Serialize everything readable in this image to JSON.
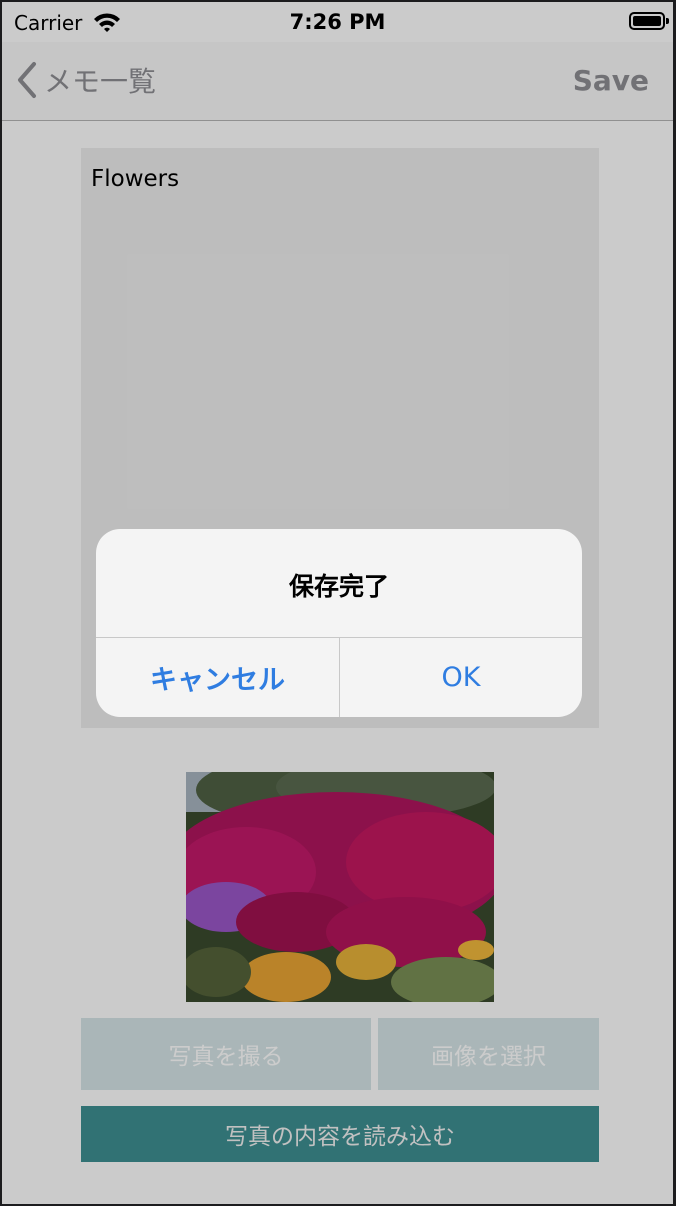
{
  "status_bar": {
    "carrier": "Carrier",
    "time": "7:26 PM"
  },
  "nav": {
    "back_label": "メモ一覧",
    "save_label": "Save"
  },
  "memo": {
    "text": "Flowers"
  },
  "buttons": {
    "take_photo": "写真を撮る",
    "select_image": "画像を選択",
    "read_photo": "写真の内容を読み込む"
  },
  "alert": {
    "title": "保存完了",
    "cancel": "キャンセル",
    "ok": "OK"
  },
  "colors": {
    "accent": "#2f7de1",
    "primary_button": "#3e8f92",
    "secondary_button": "#d5e4e6"
  },
  "icons": [
    "wifi-icon",
    "battery-icon",
    "back-chevron-icon"
  ]
}
